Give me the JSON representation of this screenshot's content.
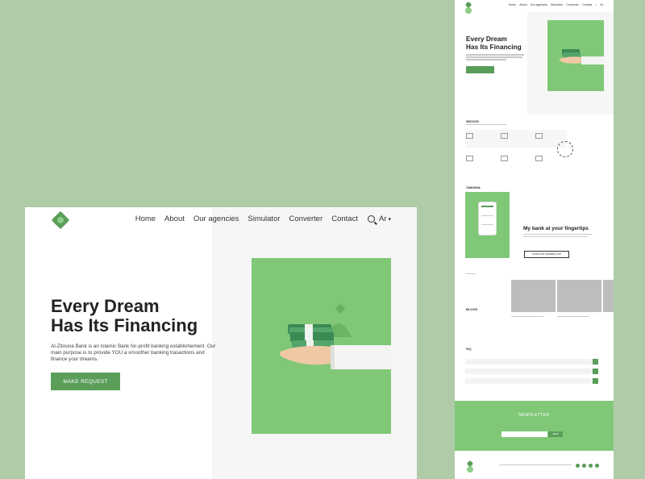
{
  "hero": {
    "nav": [
      "Home",
      "About",
      "Our agencies",
      "Simulator",
      "Converter",
      "Contact"
    ],
    "lang": "Ar",
    "title_line1": "Every Dream",
    "title_line2": "Has Its Financing",
    "description": "Al-Zitouna Bank is an Islamic Bank for-profit banking establishement. Our main purpose is to provide YOU a smoother banking trasactions and finance your dreams.",
    "cta": "MAKE REQUEST"
  },
  "preview": {
    "nav": [
      "Home",
      "About",
      "Our agencies",
      "Simulator",
      "Converter",
      "Contact"
    ],
    "lang": "Ar",
    "title_line1": "Every Dream",
    "title_line2": "Has Its Financing",
    "services_label": "SERVICES",
    "tamkeen_label": "TAMKEENIL",
    "mobile_title": "My bank at your fingertips",
    "download_cta": "DOWNLOAD TAMKEENIL APP",
    "blogs_label": "BLOGS",
    "faq_label": "FAQ",
    "newsletter_label": "NEWSLETTER",
    "subscribe": "SEND"
  },
  "colors": {
    "accent": "#5a9e59",
    "light_green": "#80c878",
    "backdrop": "#afcba8"
  }
}
